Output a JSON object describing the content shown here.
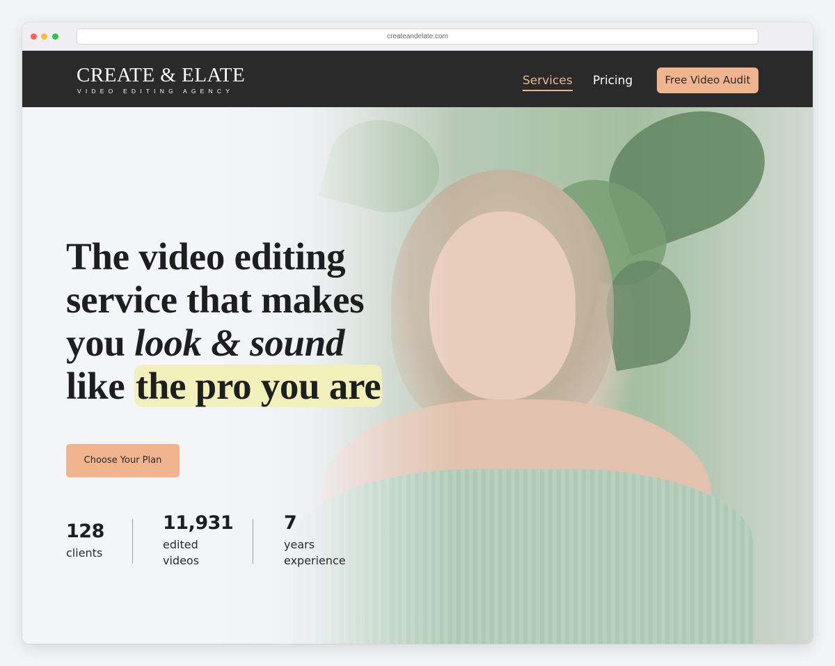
{
  "browser": {
    "url": "createandelate.com"
  },
  "nav": {
    "logo_title": "CREATE & ELATE",
    "logo_subtitle": "VIDEO EDITING AGENCY",
    "links": [
      {
        "label": "Services",
        "active": true
      },
      {
        "label": "Pricing",
        "active": false
      }
    ],
    "cta_label": "Free Video Audit"
  },
  "hero": {
    "headline": {
      "line1": "The video editing",
      "line2": "service that makes",
      "line3_plain": "you ",
      "line3_italic": "look & sound",
      "line4_plain": "like ",
      "line4_highlight": "the pro you are"
    },
    "cta_label": "Choose Your Plan",
    "stats": [
      {
        "value": "128",
        "label_line1": "clients",
        "label_line2": ""
      },
      {
        "value": "11,931",
        "label_line1": "edited",
        "label_line2": "videos"
      },
      {
        "value": "7",
        "label_line1": "years",
        "label_line2": "experience"
      }
    ]
  },
  "colors": {
    "nav_bg": "#2a2a2a",
    "accent": "#f0b48f",
    "highlight": "#f1f0ba",
    "page_bg": "#f4f5f9"
  }
}
